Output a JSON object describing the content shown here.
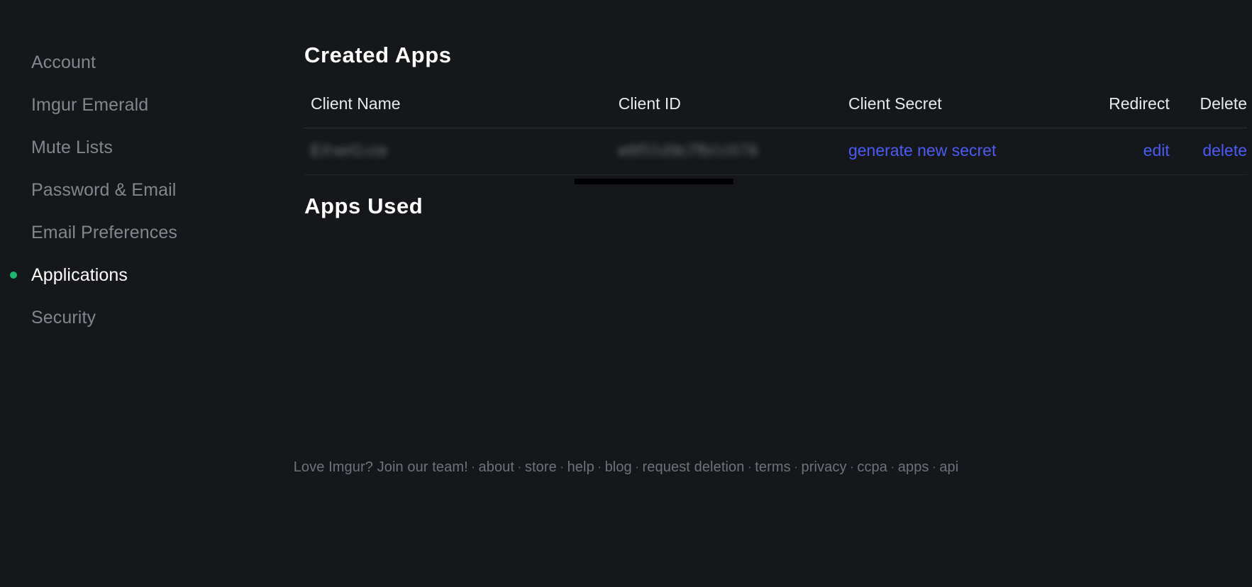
{
  "sidebar": {
    "items": [
      {
        "label": "Account",
        "active": false
      },
      {
        "label": "Imgur Emerald",
        "active": false
      },
      {
        "label": "Mute Lists",
        "active": false
      },
      {
        "label": "Password & Email",
        "active": false
      },
      {
        "label": "Email Preferences",
        "active": false
      },
      {
        "label": "Applications",
        "active": true
      },
      {
        "label": "Security",
        "active": false
      }
    ],
    "active_dot_color": "#1bb76e"
  },
  "main": {
    "created_apps_title": "Created Apps",
    "apps_used_title": "Apps Used",
    "table": {
      "headers": {
        "client_name": "Client Name",
        "client_id": "Client ID",
        "client_secret": "Client Secret",
        "redirect": "Redirect",
        "delete": "Delete"
      },
      "rows": [
        {
          "client_name": "EtherGate",
          "client_id": "e8f55d9c7fb0d876",
          "generate_secret_label": "generate new secret",
          "edit_label": "edit",
          "delete_label": "delete"
        }
      ]
    },
    "link_color": "#4a5cf5"
  },
  "footer": {
    "lead": "Love Imgur? Join our team!",
    "separator": "·",
    "links": [
      "about",
      "store",
      "help",
      "blog",
      "request deletion",
      "terms",
      "privacy",
      "ccpa",
      "apps",
      "api"
    ]
  }
}
